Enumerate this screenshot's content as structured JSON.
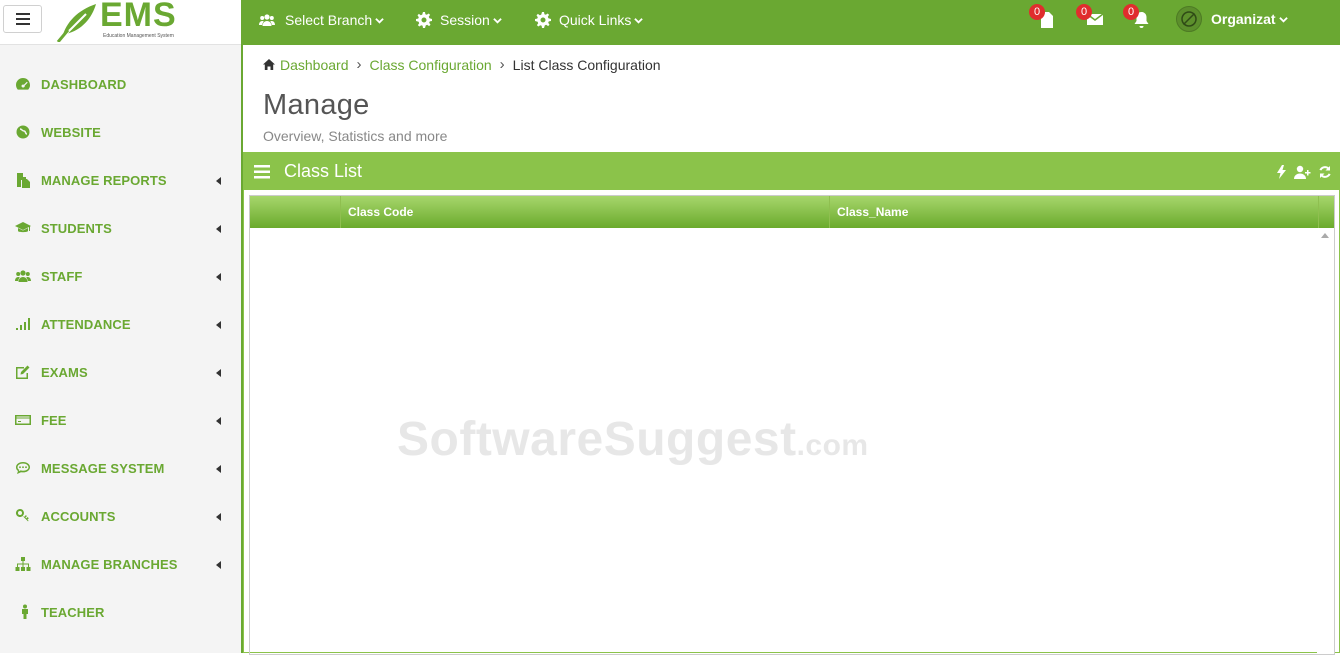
{
  "logo": {
    "title": "EMS",
    "tagline": "Education Management System"
  },
  "sidebar": {
    "items": [
      {
        "label": "DASHBOARD",
        "icon": "dashboard-icon",
        "has_submenu": false
      },
      {
        "label": "WEBSITE",
        "icon": "globe-icon",
        "has_submenu": false
      },
      {
        "label": "MANAGE REPORTS",
        "icon": "files-icon",
        "has_submenu": true
      },
      {
        "label": "STUDENTS",
        "icon": "graduation-cap-icon",
        "has_submenu": true
      },
      {
        "label": "STAFF",
        "icon": "users-icon",
        "has_submenu": true
      },
      {
        "label": "ATTENDANCE",
        "icon": "signal-icon",
        "has_submenu": true
      },
      {
        "label": "EXAMS",
        "icon": "edit-icon",
        "has_submenu": true
      },
      {
        "label": "FEE",
        "icon": "credit-card-icon",
        "has_submenu": true
      },
      {
        "label": "MESSAGE SYSTEM",
        "icon": "comment-icon",
        "has_submenu": true
      },
      {
        "label": "ACCOUNTS",
        "icon": "key-icon",
        "has_submenu": true
      },
      {
        "label": "MANAGE BRANCHES",
        "icon": "sitemap-icon",
        "has_submenu": true
      },
      {
        "label": "TEACHER",
        "icon": "person-icon",
        "has_submenu": false
      }
    ]
  },
  "topbar": {
    "select_branch": "Select Branch",
    "session": "Session",
    "quick_links": "Quick Links",
    "notifications": [
      {
        "icon": "file-icon",
        "count": "0"
      },
      {
        "icon": "envelope-icon",
        "count": "0"
      },
      {
        "icon": "bell-icon",
        "count": "0"
      }
    ],
    "user_label": "Organizat"
  },
  "breadcrumb": {
    "items": [
      "Dashboard",
      "Class Configuration"
    ],
    "current": "List Class Configuration"
  },
  "page": {
    "title": "Manage",
    "subtitle": "Overview, Statistics and more"
  },
  "panel": {
    "title": "Class List",
    "tools": [
      "bolt-icon",
      "add-user-icon",
      "refresh-icon"
    ],
    "columns": [
      "",
      "Class Code",
      "Class_Name"
    ],
    "rows": []
  },
  "watermark": {
    "text": "SoftwareSuggest",
    "suffix": ".com"
  },
  "colors": {
    "brand_green": "#6aa832",
    "panel_green": "#8bc34a",
    "badge_red": "#e02d2d"
  }
}
